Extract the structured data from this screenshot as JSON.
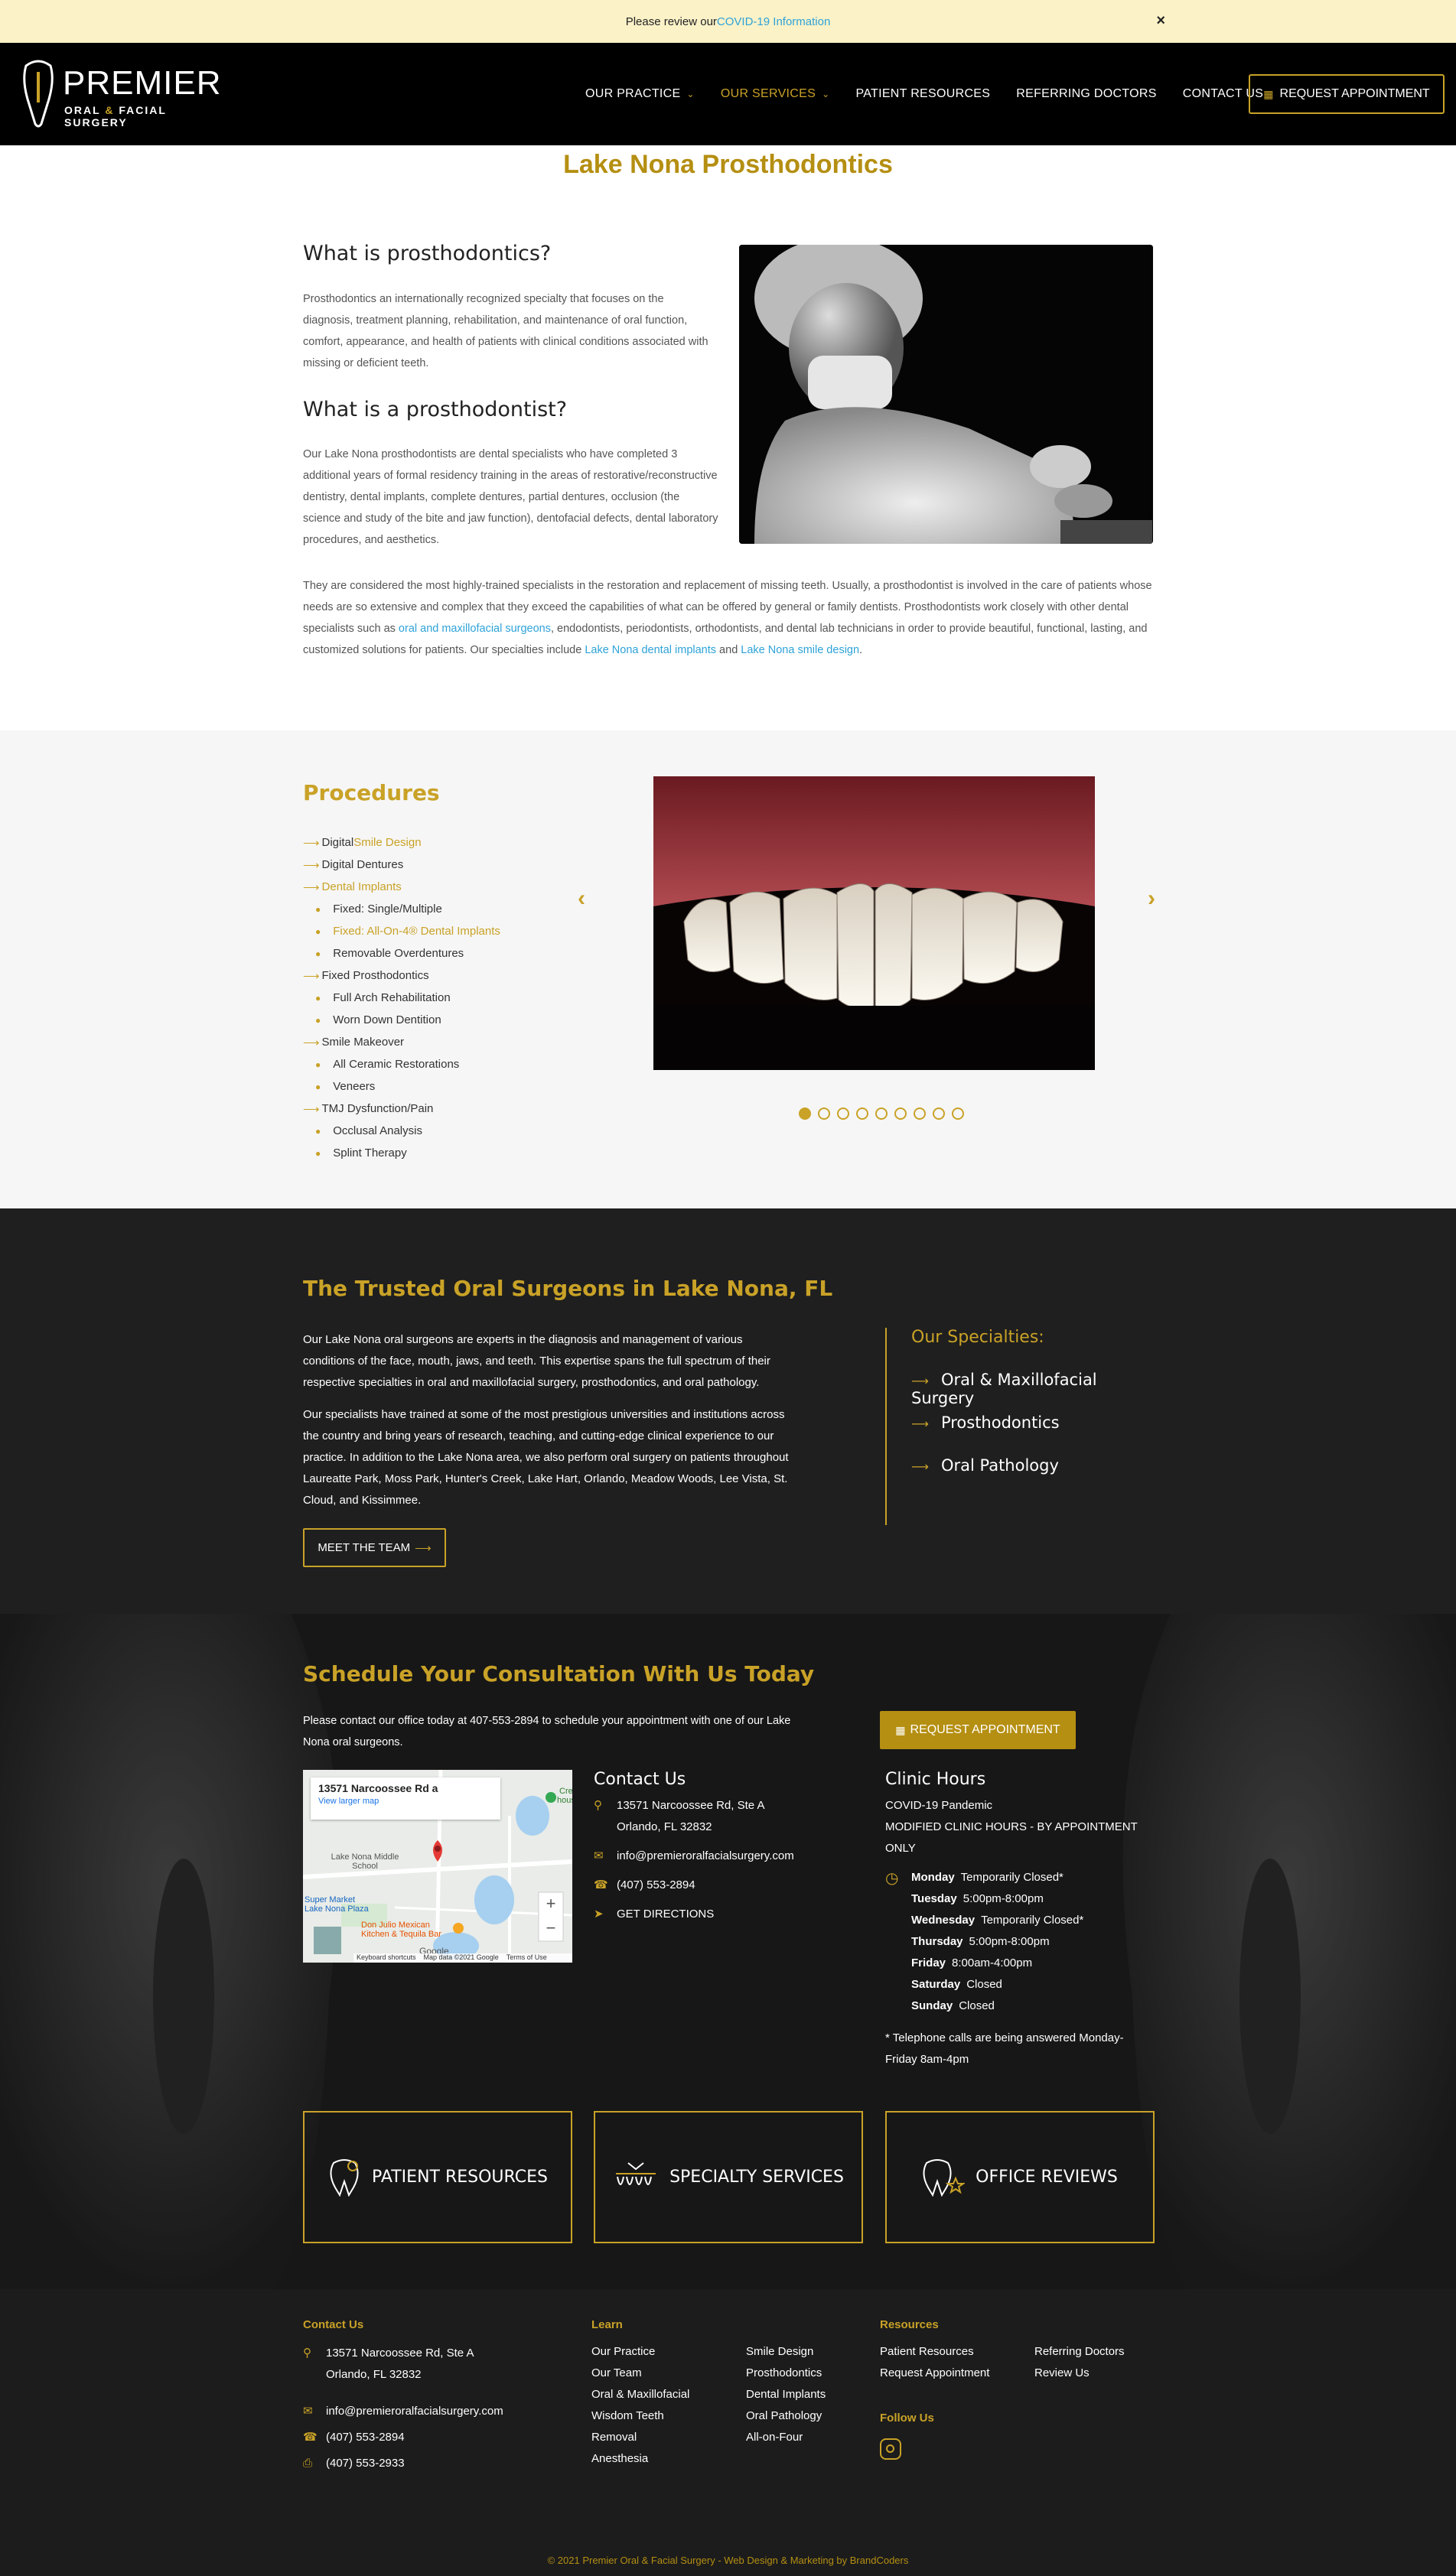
{
  "covid_bar": {
    "text": "Please review our ",
    "link": "COVID-19 Information",
    "close": "×"
  },
  "header": {
    "logo": {
      "name": "PREMIER",
      "sub1": "ORAL ",
      "amp": "&",
      "sub2": " FACIAL SURGERY"
    },
    "nav": [
      {
        "label": "OUR PRACTICE",
        "dropdown": true
      },
      {
        "label": "OUR SERVICES",
        "dropdown": true,
        "active": true
      },
      {
        "label": "PATIENT RESOURCES"
      },
      {
        "label": "REFERRING DOCTORS"
      },
      {
        "label": "CONTACT US"
      }
    ],
    "cta": "REQUEST APPOINTMENT"
  },
  "page_title": "Lake Nona Prosthodontics",
  "intro": {
    "h1": "What is prosthodontics?",
    "p1": "Prosthodontics an internationally recognized specialty that focuses on the diagnosis, treatment planning, rehabilitation, and maintenance of oral function, comfort, appearance, and health of patients with clinical conditions associated with missing or deficient teeth.",
    "h2": "What is a prosthodontist?",
    "p2": "Our Lake Nona prosthodontists are dental specialists who have completed 3 additional years of formal residency training in the areas of restorative/reconstructive dentistry, dental implants, complete dentures, partial dentures, occlusion (the science and study of the bite and jaw function), dentofacial defects, dental laboratory procedures, and aesthetics.",
    "p3a": "They are considered the most highly-trained specialists in the restoration and replacement of missing teeth. Usually, a prosthodontist is involved in the care of patients whose needs are so extensive and complex that they exceed the capabilities of what can be offered by general or family dentists. Prosthodontists work closely with other dental specialists such as ",
    "p3link1": "oral and maxillofacial surgeons",
    "p3b": ", endodontists, periodontists, orthodontists, and dental lab technicians in order to provide beautiful, functional, lasting, and customized solutions for patients. Our specialties include ",
    "p3link2": "Lake Nona dental implants",
    "p3c": " and ",
    "p3link3": "Lake Nona smile design",
    "p3d": "."
  },
  "procedures": {
    "title": "Procedures",
    "items": [
      {
        "label": "Digital ",
        "hl": "Smile Design",
        "level": 0
      },
      {
        "label": "Digital Dentures",
        "level": 0
      },
      {
        "label": "Dental Implants",
        "level": 0,
        "highlight": true
      },
      {
        "label": "Fixed: Single/Multiple",
        "level": 1
      },
      {
        "label": "Fixed: All-On-4® Dental Implants",
        "level": 1,
        "highlight": true
      },
      {
        "label": "Removable Overdentures",
        "level": 1
      },
      {
        "label": "Fixed Prosthodontics",
        "level": 0
      },
      {
        "label": "Full Arch Rehabilitation",
        "level": 1
      },
      {
        "label": "Worn Down Dentition",
        "level": 1
      },
      {
        "label": "Smile Makeover",
        "level": 0
      },
      {
        "label": "All Ceramic Restorations",
        "level": 1
      },
      {
        "label": "Veneers",
        "level": 1
      },
      {
        "label": "TMJ Dysfunction/Pain",
        "level": 0
      },
      {
        "label": "Occlusal Analysis",
        "level": 1
      },
      {
        "label": "Splint Therapy",
        "level": 1
      }
    ],
    "slider_count": 9,
    "slider_active": 0
  },
  "trusted": {
    "title": "The Trusted Oral Surgeons in Lake Nona, FL",
    "p1": "Our Lake Nona oral surgeons are experts in the diagnosis and management of various conditions of the face, mouth, jaws, and teeth. This expertise spans the full spectrum of their respective specialties in oral and maxillofacial surgery, prosthodontics, and oral pathology.",
    "p2": "Our specialists have trained at some of the most prestigious universities and institutions across the country and bring years of research, teaching, and cutting-edge clinical experience to our practice. In addition to the Lake Nona area, we also perform oral surgery on patients throughout Laureatte Park, Moss Park, Hunter's Creek, Lake Hart, Orlando, Meadow Woods, Lee Vista, St. Cloud, and Kissimmee.",
    "button": "MEET THE TEAM",
    "specialties_title": "Our Specialties:",
    "specialties": [
      "Oral & Maxillofacial Surgery",
      "Prosthodontics",
      "Oral Pathology"
    ]
  },
  "schedule": {
    "title": "Schedule Your Consultation With Us Today",
    "text": "Please contact our office today at 407-553-2894 to schedule your appointment with one of our Lake Nona oral surgeons.",
    "button": "REQUEST APPOINTMENT",
    "map": {
      "place": "13571 Narcoossee Rd a",
      "larger": "View larger map",
      "labels": [
        "Lake Nona Middle School",
        "Creek",
        "house",
        "Super Market",
        "Lake Nona Plaza",
        "Don Julio Mexican",
        "Kitchen & Tequila Bar"
      ],
      "footer": [
        "Keyboard shortcuts",
        "Map data ©2021 Google",
        "Terms of Use"
      ],
      "google": "Google"
    },
    "contact": {
      "title": "Contact Us",
      "address1": "13571 Narcoossee Rd, Ste A",
      "address2": "Orlando, FL 32832",
      "email": "info@premieroralfacialsurgery.com",
      "phone": "(407) 553-2894",
      "directions": "GET DIRECTIONS"
    },
    "hours": {
      "title": "Clinic Hours",
      "notice1": "COVID-19 Pandemic",
      "notice2": "MODIFIED CLINIC HOURS - BY APPOINTMENT ONLY",
      "days": [
        {
          "day": "Monday",
          "time": "Temporarily Closed*"
        },
        {
          "day": "Tuesday",
          "time": "5:00pm-8:00pm"
        },
        {
          "day": "Wednesday",
          "time": "Temporarily Closed*"
        },
        {
          "day": "Thursday",
          "time": "5:00pm-8:00pm"
        },
        {
          "day": "Friday",
          "time": "8:00am-4:00pm"
        },
        {
          "day": "Saturday",
          "time": "Closed"
        },
        {
          "day": "Sunday",
          "time": "Closed"
        }
      ],
      "note": "* Telephone calls are being answered Monday-Friday 8am-4pm"
    },
    "cards": [
      "PATIENT RESOURCES",
      "SPECIALTY SERVICES",
      "OFFICE REVIEWS"
    ]
  },
  "footer": {
    "contact_title": "Contact Us",
    "address1": "13571 Narcoossee Rd, Ste A",
    "address2": "Orlando, FL 32832",
    "email": "info@premieroralfacialsurgery.com",
    "phone": "(407) 553-2894",
    "fax": "(407) 553-2933",
    "learn_title": "Learn",
    "learn_col1": [
      "Our Practice",
      "Our Team",
      "Oral & Maxillofacial",
      "Wisdom Teeth",
      "Removal",
      "Anesthesia"
    ],
    "learn_col2": [
      "Smile Design",
      "Prosthodontics",
      "Dental Implants",
      "Oral Pathology",
      "All-on-Four"
    ],
    "resources_title": "Resources",
    "res_col1": [
      "Patient Resources",
      "Request Appointment"
    ],
    "res_col2": [
      "Referring Doctors",
      "Review Us"
    ],
    "follow_title": "Follow Us",
    "copyright": "© 2021 Premier Oral & Facial Surgery - Web Design & Marketing by BrandCoders"
  },
  "colors": {
    "accent": "#c9a227",
    "link": "#2ea3d8",
    "dark": "#1f1f1f"
  }
}
